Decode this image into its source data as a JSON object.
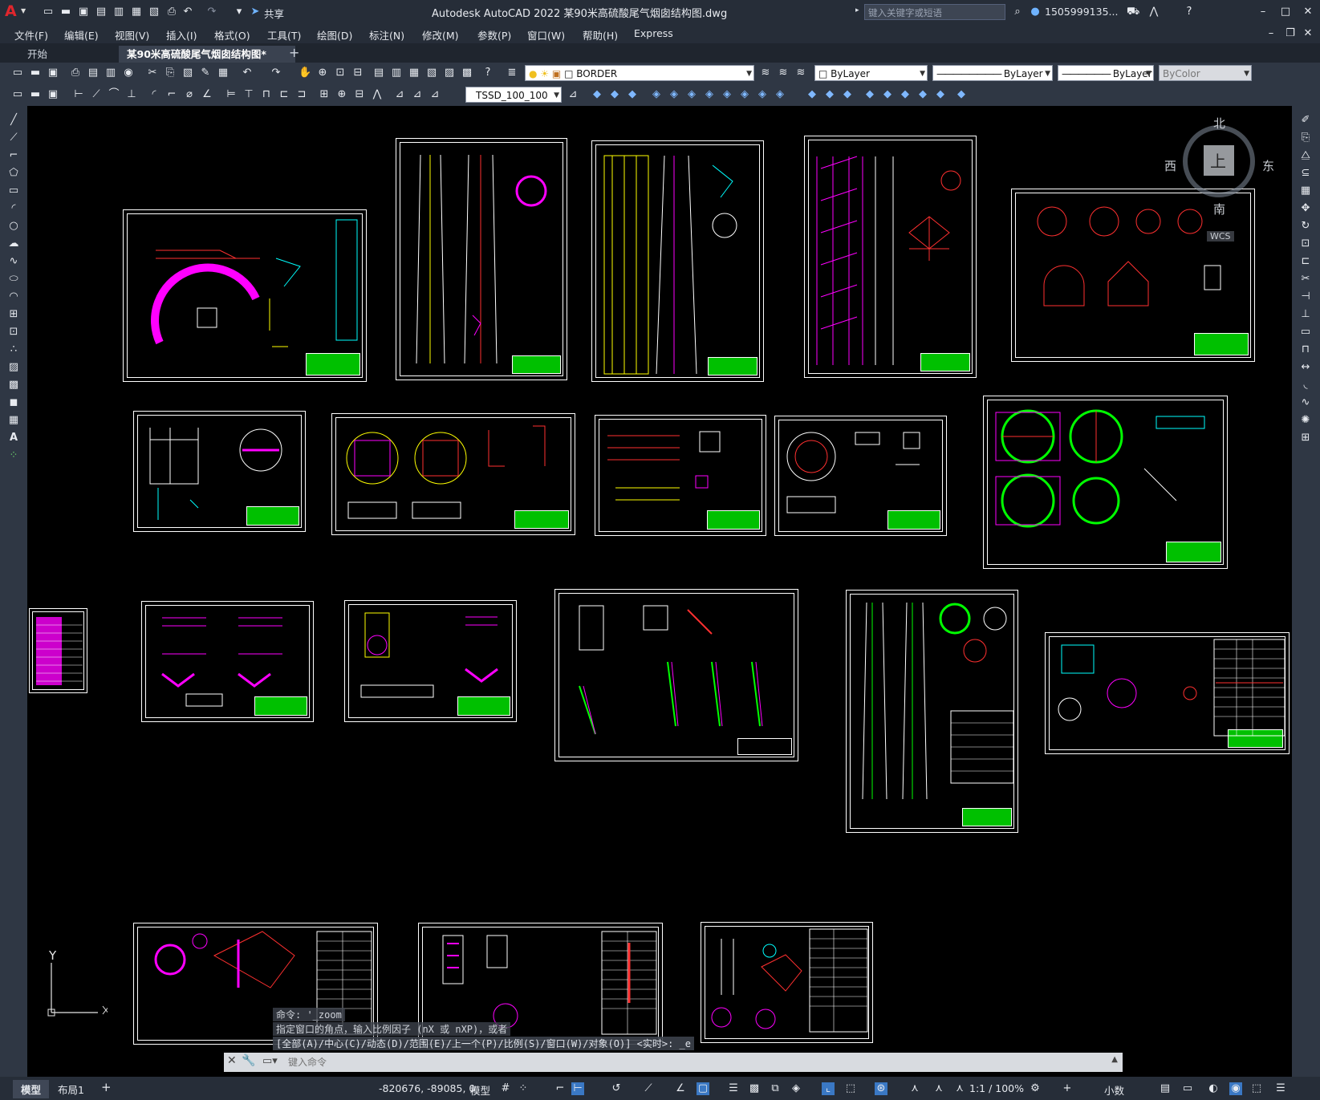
{
  "titlebar": {
    "app_logo": "A",
    "share_label": "共享",
    "title": "Autodesk AutoCAD 2022    某90米高硫酸尾气烟囱结构图.dwg",
    "search_placeholder": "键入关键字或短语",
    "user": "1505999135...",
    "icons": [
      "new-icon",
      "open-icon",
      "save-icon",
      "saveas-icon",
      "plot-icon",
      "print-icon",
      "undo-icon",
      "redo-icon",
      "share-icon",
      "search-icon",
      "user-icon",
      "cart-icon",
      "help-icon",
      "minimize-icon",
      "maximize-icon",
      "close-icon"
    ]
  },
  "menubar": {
    "items": [
      "文件(F)",
      "编辑(E)",
      "视图(V)",
      "插入(I)",
      "格式(O)",
      "工具(T)",
      "绘图(D)",
      "标注(N)",
      "修改(M)",
      "参数(P)",
      "窗口(W)",
      "帮助(H)",
      "Express"
    ]
  },
  "tabs": {
    "items": [
      "开始",
      "某90米高硫酸尾气烟囱结构图*"
    ],
    "add": "+"
  },
  "toolbar": {
    "layer": "BORDER",
    "color": "ByLayer",
    "linetype": "ByLayer",
    "lineweight": "ByLayer",
    "plotstyle": "ByColor",
    "dimstyle": "TSSD_100_100"
  },
  "viewcube": {
    "north": "北",
    "south": "南",
    "east": "东",
    "west": "西",
    "face": "上",
    "wcs": "WCS"
  },
  "ucs": {
    "y": "Y",
    "x": "X"
  },
  "command": {
    "history_1": "命令:  '_zoom",
    "history_2": "指定窗口的角点，输入比例因子 (nX 或 nXP)，或者",
    "history_3": "[全部(A)/中心(C)/动态(D)/范围(E)/上一个(P)/比例(S)/窗口(W)/对象(O)] <实时>: _e",
    "placeholder": "键入命令"
  },
  "statusbar": {
    "layout_tabs": [
      "模型",
      "布局1"
    ],
    "add": "+",
    "coords": "-820676, -89085, 0",
    "space": "模型",
    "scale": "1:1 / 100%",
    "units": "小数"
  },
  "colors": {
    "canvas": "#000000",
    "chrome": "#2b3340",
    "title_block": "#00c000"
  }
}
